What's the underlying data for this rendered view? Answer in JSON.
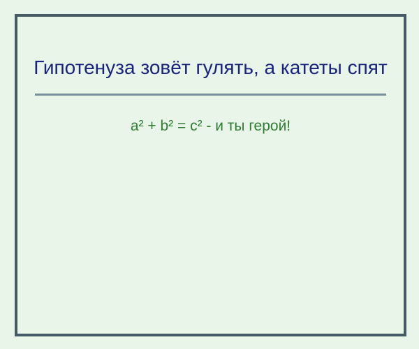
{
  "card": {
    "title": "Гипотенуза зовёт гулять, а катеты спят",
    "formula": "a² + b² = c² - и ты герой!"
  },
  "colors": {
    "background": "#e9f5e9",
    "border": "#455a64",
    "title": "#1a237e",
    "divider": "#78909c",
    "formula": "#2e7d32"
  }
}
